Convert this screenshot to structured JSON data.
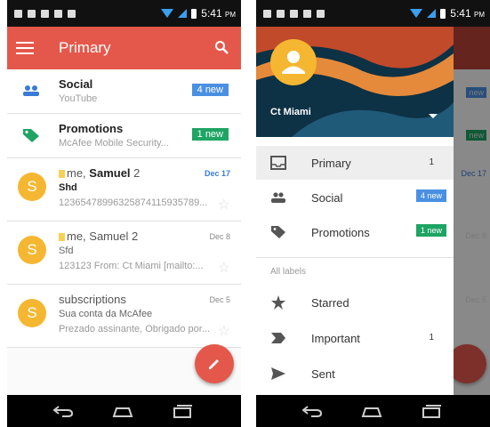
{
  "status": {
    "time": "5:41",
    "ampm": "PM"
  },
  "inbox": {
    "title": "Primary",
    "categories": [
      {
        "name": "Social",
        "sub": "YouTube",
        "badge": "4 new",
        "badge_color": "#4a90e2",
        "icon": "people-icon"
      },
      {
        "name": "Promotions",
        "sub": "McAfee Mobile Security...",
        "badge": "1 new",
        "badge_color": "#1ea463",
        "icon": "tag-icon"
      }
    ],
    "threads": [
      {
        "avatar": "S",
        "sender_pre": "me, ",
        "sender_bold": "Samuel",
        "count": "2",
        "date": "Dec 17",
        "subject": "Shd",
        "snippet": "12365478996325874115935789...",
        "unread": true
      },
      {
        "avatar": "S",
        "sender_pre": "me, Samuel",
        "sender_bold": "",
        "count": "2",
        "date": "Dec 8",
        "subject": "Sfd",
        "snippet": "123123 From: Ct Miami [mailto:...",
        "unread": false
      },
      {
        "avatar": "S",
        "sender_pre": "subscriptions",
        "sender_bold": "",
        "count": "",
        "date": "Dec 5",
        "subject": "Sua conta da McAfee",
        "snippet": "Prezado assinante, Obrigado por...",
        "unread": false
      }
    ]
  },
  "drawer": {
    "account_name": "Ct Miami",
    "items": [
      {
        "label": "Primary",
        "count": "1",
        "selected": true,
        "icon": "inbox-icon"
      },
      {
        "label": "Social",
        "badge": "4 new",
        "badge_color": "#4a90e2",
        "icon": "people-icon"
      },
      {
        "label": "Promotions",
        "badge": "1 new",
        "badge_color": "#1ea463",
        "icon": "tag-icon"
      }
    ],
    "section_label": "All labels",
    "labels": [
      {
        "label": "Starred",
        "count": "",
        "icon": "star-icon"
      },
      {
        "label": "Important",
        "count": "1",
        "icon": "important-icon"
      },
      {
        "label": "Sent",
        "count": "",
        "icon": "send-icon"
      }
    ],
    "behind_text": {
      "badge1": "new",
      "badge2": "new",
      "date1": "Dec 17",
      "date2": "Dec 8",
      "date3": "Dec 5"
    }
  },
  "colors": {
    "accent": "#e4584b",
    "avatar": "#f5b731",
    "blue": "#4a90e2",
    "green": "#1ea463"
  }
}
